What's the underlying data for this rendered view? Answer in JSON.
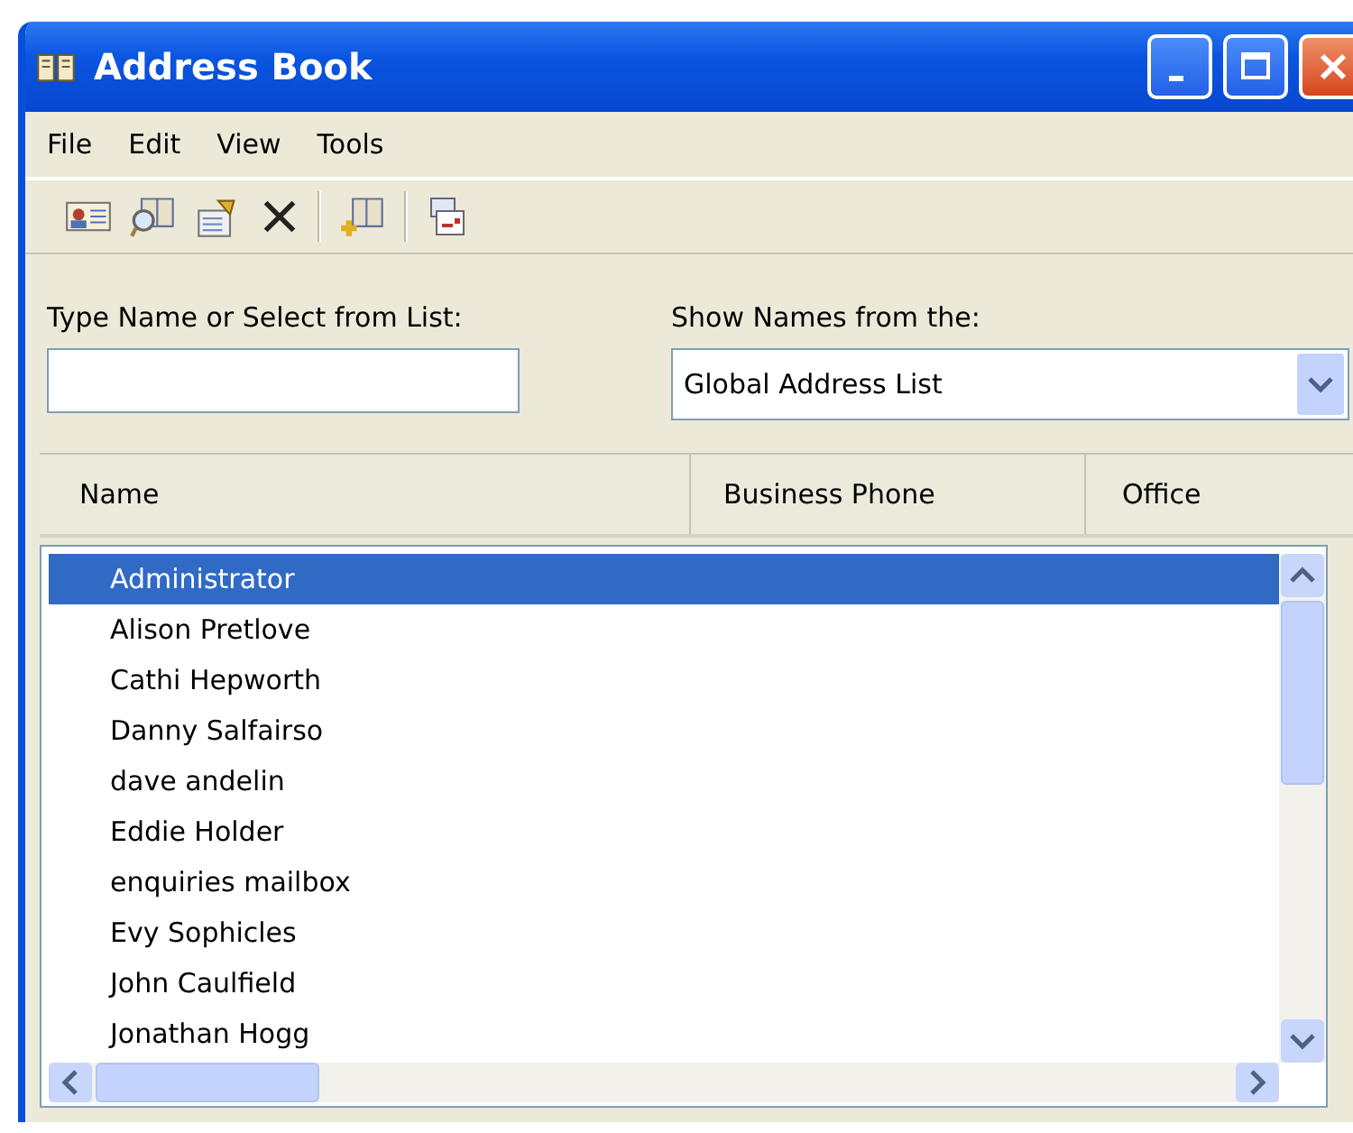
{
  "window": {
    "title": "Address Book"
  },
  "menu": [
    "File",
    "Edit",
    "View",
    "Tools"
  ],
  "search": {
    "label": "Type Name or Select from List:"
  },
  "source": {
    "label": "Show Names from the:",
    "value": "Global Address List"
  },
  "table": {
    "columns": [
      "Name",
      "Business Phone",
      "Office"
    ],
    "rows": [
      {
        "name": "Administrator",
        "selected": true
      },
      {
        "name": "Alison Pretlove",
        "selected": false
      },
      {
        "name": "Cathi Hepworth",
        "selected": false
      },
      {
        "name": "Danny Salfairso",
        "selected": false
      },
      {
        "name": "dave andelin",
        "selected": false
      },
      {
        "name": "Eddie Holder",
        "selected": false
      },
      {
        "name": "enquiries mailbox",
        "selected": false
      },
      {
        "name": "Evy Sophicles",
        "selected": false
      },
      {
        "name": "John Caulfield",
        "selected": false
      },
      {
        "name": "Jonathan Hogg",
        "selected": false
      }
    ]
  }
}
